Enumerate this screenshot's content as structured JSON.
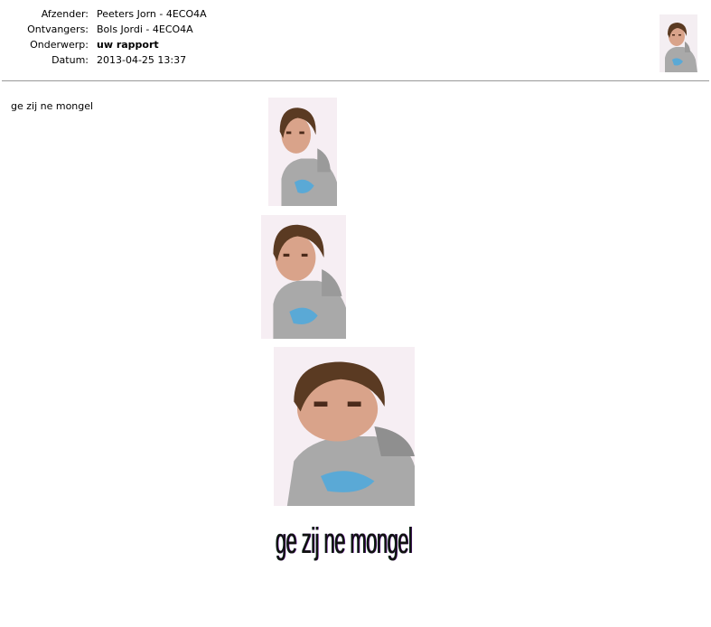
{
  "message": {
    "fields": [
      {
        "label": "Afzender:",
        "value": "Peeters Jorn - 4ECO4A",
        "bold": false
      },
      {
        "label": "Ontvangers:",
        "value": "Bols Jordi - 4ECO4A",
        "bold": false
      },
      {
        "label": "Onderwerp:",
        "value": "uw rapport",
        "bold": true
      },
      {
        "label": "Datum:",
        "value": "2013-04-25 13:37",
        "bold": false
      }
    ],
    "body_text": "ge zij ne mongel",
    "image_caption": "ge zij ne mongel"
  },
  "icons": {
    "sender_avatar": "person-photo",
    "attached_photos": [
      "person-photo",
      "person-photo",
      "person-photo"
    ]
  },
  "colors": {
    "background": "#ffffff",
    "divider": "#999999",
    "hoodie": "#a9a9a9",
    "hair": "#5a3a22",
    "skin": "#d9a38a",
    "shirt_print": "#5aa9d6"
  }
}
